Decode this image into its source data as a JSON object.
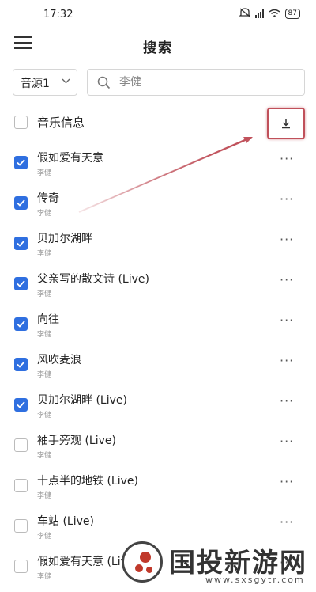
{
  "status_bar": {
    "time": "17:32",
    "battery": "87",
    "signal_text": "HD"
  },
  "header": {
    "title": "搜索"
  },
  "source_select": {
    "value": "音源1"
  },
  "search": {
    "value": "李健"
  },
  "select_all": {
    "label": "音乐信息"
  },
  "songs": [
    {
      "name": "假如爱有天意",
      "artist": "李健",
      "checked": true
    },
    {
      "name": "传奇",
      "artist": "李健",
      "checked": true
    },
    {
      "name": "贝加尔湖畔",
      "artist": "李健",
      "checked": true
    },
    {
      "name": "父亲写的散文诗 (Live)",
      "artist": "李健",
      "checked": true
    },
    {
      "name": "向往",
      "artist": "李健",
      "checked": true
    },
    {
      "name": "风吹麦浪",
      "artist": "李健",
      "checked": true
    },
    {
      "name": "贝加尔湖畔 (Live)",
      "artist": "李健",
      "checked": true
    },
    {
      "name": "袖手旁观 (Live)",
      "artist": "李健",
      "checked": false
    },
    {
      "name": "十点半的地铁 (Live)",
      "artist": "李健",
      "checked": false
    },
    {
      "name": "车站 (Live)",
      "artist": "李健",
      "checked": false
    },
    {
      "name": "假如爱有天意 (Live)",
      "artist": "李健",
      "checked": false
    }
  ],
  "more_label": "···",
  "watermark": {
    "text": "国投新游网",
    "url": "www.sxsgytr.com"
  },
  "colors": {
    "accent": "#2f6fe0",
    "highlight": "#c0505a"
  }
}
